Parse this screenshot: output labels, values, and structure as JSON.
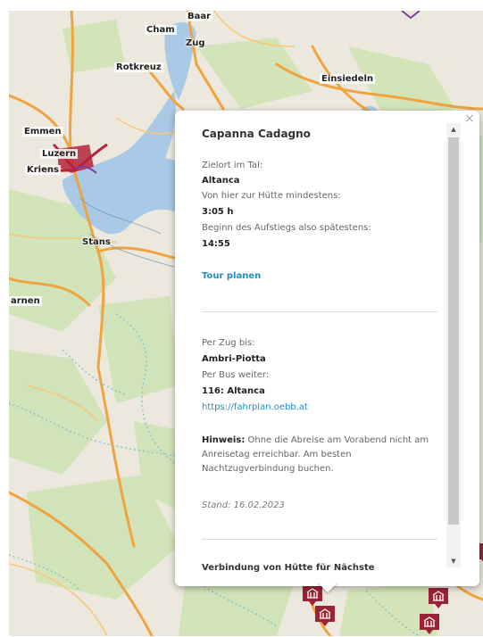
{
  "map": {
    "towns": [
      "Baar",
      "Cham",
      "Zug",
      "Rotkreuz",
      "Einsiedeln",
      "Emmen",
      "Luzern",
      "Kriens",
      "Stans",
      "arnen"
    ],
    "colors": {
      "land": "#ece8dd",
      "water": "#a9c9e6",
      "road": "#f0a440",
      "motorway": "#e56d8c",
      "forest": "#c9dfb0",
      "boundary": "#6fb7c3"
    }
  },
  "popup": {
    "title": "Capanna Cadagno",
    "close": "×",
    "tal_label": "Zielort im Tal:",
    "tal_value": "Altanca",
    "min_label": "Von hier zur Hütte mindestens:",
    "min_value": "3:05 h",
    "start_label": "Beginn des Aufstiegs also spätestens:",
    "start_value": "14:55",
    "tour_link": "Tour planen",
    "zug_label": "Per Zug bis:",
    "zug_value": "Ambri-Piotta",
    "bus_label": "Per Bus weiter:",
    "bus_value": "116: Altanca",
    "fahrplan_link": "https://fahrplan.oebb.at",
    "hinweis_label": "Hinweis:",
    "hinweis_text": " Ohne die Abreise am Vorabend nicht am Anreisetag erreichbar. Am besten Nachtzugverbindung buchen.",
    "stand": "Stand: 16.02.2023",
    "cutoff_text": "Verbindung von Hütte für Nächste"
  },
  "scrollbar": {
    "up_icon": "▲",
    "down_icon": "▼"
  },
  "marker_icon": "hut-icon"
}
